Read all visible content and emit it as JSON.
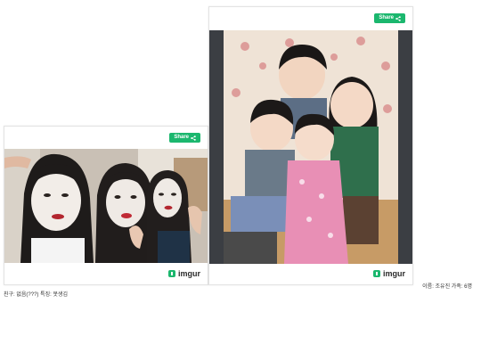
{
  "embed_1": {
    "share_label": "Share",
    "brand": "imgur",
    "photo": "Three girls with white face masks making poses"
  },
  "embed_2": {
    "share_label": "Share",
    "brand": "imgur",
    "photo": "Group of smiling children hugging on a floor"
  },
  "captions": {
    "right": "이름: 조유진 가족: 6명",
    "left": "친구: 없음(???) 특징: 못생김"
  },
  "colors": {
    "share_button": "#1bb76e",
    "border": "#e3e3e3"
  },
  "icons": [
    "share-icon",
    "imgur-logo-icon"
  ]
}
